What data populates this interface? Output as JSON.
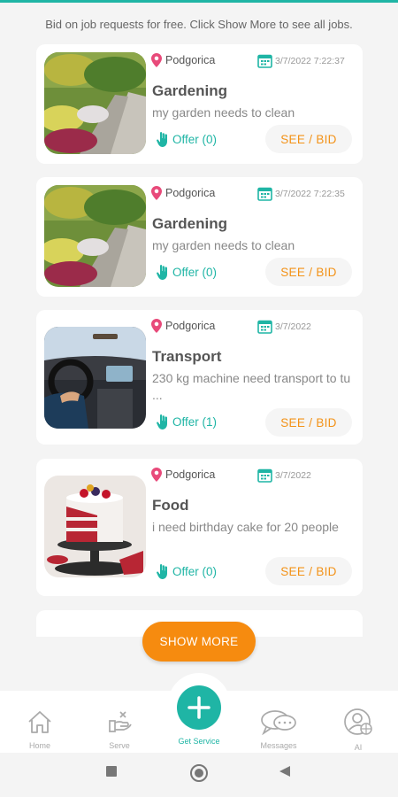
{
  "intro_text": "Bid on job requests for free. Click Show More to see all jobs.",
  "jobs": [
    {
      "location": "Podgorica",
      "date": "3/7/2022 7:22:37",
      "title": "Gardening",
      "description": "my garden needs to clean",
      "offer": "Offer (0)",
      "bid": "SEE / BID",
      "image": "garden-image"
    },
    {
      "location": "Podgorica",
      "date": "3/7/2022 7:22:35",
      "title": "Gardening",
      "description": "my garden needs to clean",
      "offer": "Offer (0)",
      "bid": "SEE / BID",
      "image": "garden-image"
    },
    {
      "location": "Podgorica",
      "date": "3/7/2022",
      "title": "Transport",
      "description": "230 kg machine need transport to tu ...",
      "offer": "Offer (1)",
      "bid": "SEE / BID",
      "image": "car-interior-image"
    },
    {
      "location": "Podgorica",
      "date": "3/7/2022",
      "title": "Food",
      "description": "i need birthday cake for 20 people",
      "offer": "Offer (0)",
      "bid": "SEE / BID",
      "image": "cake-image"
    }
  ],
  "show_more": "SHOW MORE",
  "nav": {
    "home": "Home",
    "serve": "Serve",
    "get_service": "Get Service",
    "messages": "Messages",
    "ai": "AI"
  },
  "colors": {
    "accent": "#1fb5a5",
    "orange": "#f68b0f",
    "pin": "#e84a7a"
  }
}
